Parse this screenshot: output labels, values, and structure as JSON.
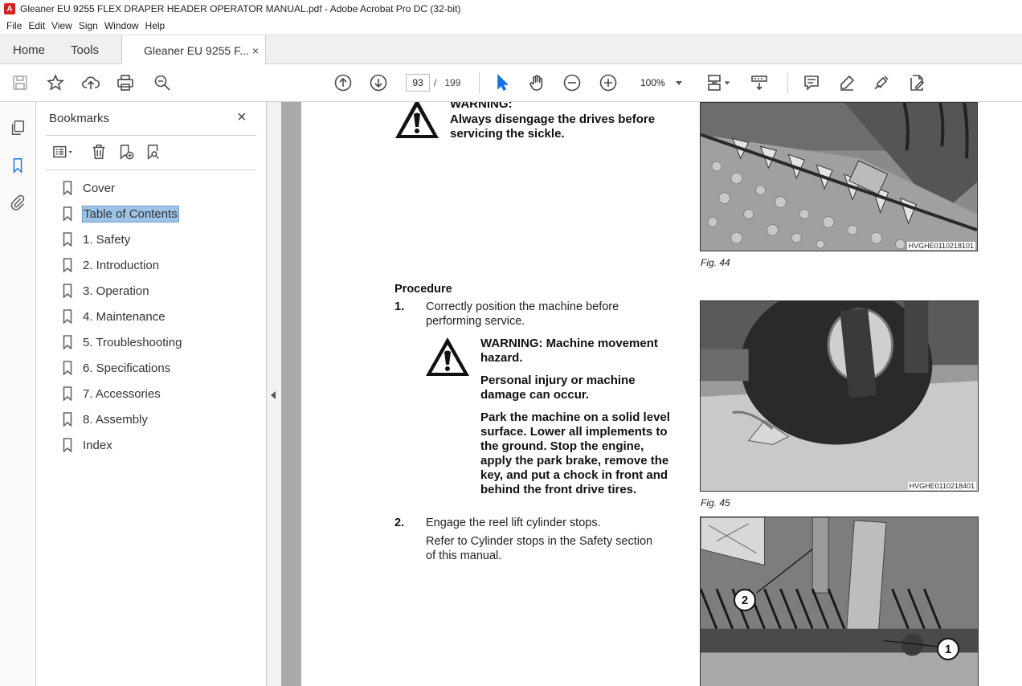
{
  "window": {
    "title": "Gleaner EU 9255 FLEX DRAPER HEADER OPERATOR MANUAL.pdf - Adobe Acrobat Pro DC (32-bit)"
  },
  "menu": [
    "File",
    "Edit",
    "View",
    "Sign",
    "Window",
    "Help"
  ],
  "tabs": {
    "home": "Home",
    "tools": "Tools",
    "document": "Gleaner EU 9255 F...",
    "close": "×"
  },
  "toolbar": {
    "page_current": "93",
    "page_sep": "/",
    "page_total": "199",
    "zoom": "100%"
  },
  "bookmarks": {
    "title": "Bookmarks",
    "close": "×",
    "items": [
      "Cover",
      "Table of Contents",
      "1. Safety",
      "2. Introduction",
      "3. Operation",
      "4. Maintenance",
      "5. Troubleshooting",
      "6. Specifications",
      "7. Accessories",
      "8. Assembly",
      "Index"
    ],
    "selected_index": 1
  },
  "document": {
    "warning1_title": "WARNING:",
    "warning1_body1": "Always disengage the drives before",
    "warning1_body2": "servicing the sickle.",
    "fig44_code": "HVGHE0110218101",
    "fig44_caption": "Fig. 44",
    "procedure_heading": "Procedure",
    "step1_num": "1.",
    "step1_line1": "Correctly position the machine before",
    "step1_line2": "performing service.",
    "warning2_line1": "WARNING: Machine movement",
    "warning2_line2": "hazard.",
    "warning2_p2_line1": "Personal injury or machine",
    "warning2_p2_line2": "damage can occur.",
    "warning2_p3": [
      "Park the machine on a solid level",
      "surface. Lower all implements to",
      "the ground. Stop the engine,",
      "apply the park brake, remove the",
      "key, and put a chock in front and",
      "behind the front drive tires."
    ],
    "fig45_code": "HVGHE0110218401",
    "fig45_caption": "Fig. 45",
    "step2_num": "2.",
    "step2_line1": "Engage the reel lift cylinder stops.",
    "step2_ref1": "Refer to Cylinder stops in the Safety section",
    "step2_ref2": "of this manual.",
    "fig46_callout1": "1",
    "fig46_callout2": "2"
  }
}
